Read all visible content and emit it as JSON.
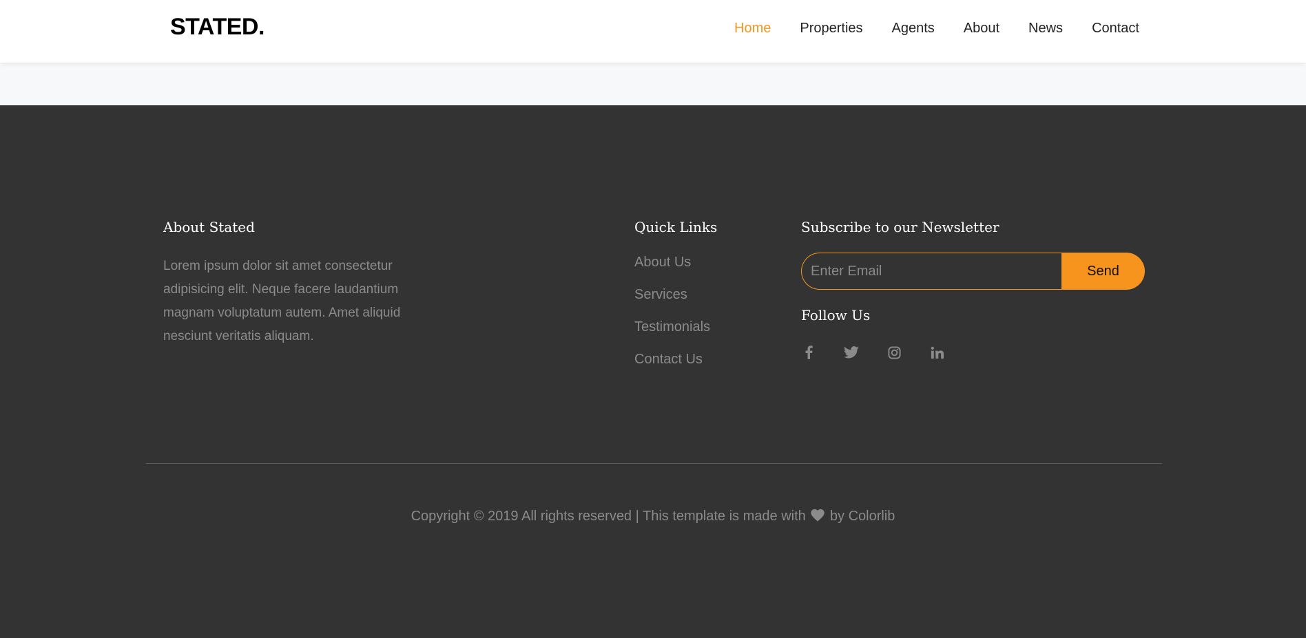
{
  "header": {
    "logo": "STATED.",
    "nav": [
      {
        "label": "Home",
        "active": true
      },
      {
        "label": "Properties",
        "active": false
      },
      {
        "label": "Agents",
        "active": false
      },
      {
        "label": "About",
        "active": false
      },
      {
        "label": "News",
        "active": false
      },
      {
        "label": "Contact",
        "active": false
      }
    ]
  },
  "footer": {
    "about": {
      "title": "About Stated",
      "text": "Lorem ipsum dolor sit amet consectetur adipisicing elit. Neque facere laudantium magnam voluptatum autem. Amet aliquid nesciunt veritatis aliquam."
    },
    "quick_links": {
      "title": "Quick Links",
      "items": [
        "About Us",
        "Services",
        "Testimonials",
        "Contact Us"
      ]
    },
    "newsletter": {
      "title": "Subscribe to our Newsletter",
      "input_placeholder": "Enter Email",
      "input_value": "",
      "button_label": "Send"
    },
    "follow": {
      "title": "Follow Us",
      "icons": [
        "facebook-icon",
        "twitter-icon",
        "instagram-icon",
        "linkedin-icon"
      ]
    },
    "copyright": {
      "before": "Copyright © 2019 All rights reserved | This template is made with",
      "heart_icon": "heart-icon",
      "after": "by Colorlib"
    }
  },
  "colors": {
    "accent": "#f7941d",
    "footer_bg": "#333333",
    "muted_text": "#8b8b8b",
    "header_bg": "#ffffff",
    "band_bg": "#f7f8fa"
  }
}
